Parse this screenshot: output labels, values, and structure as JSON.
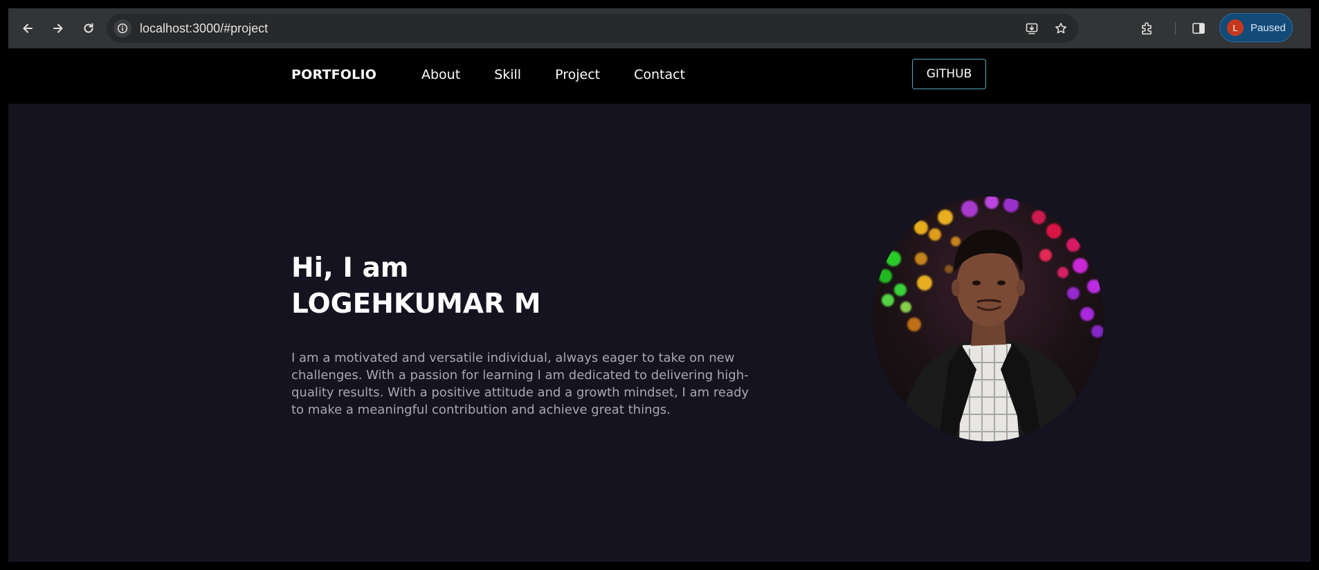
{
  "browser": {
    "url": "localhost:3000/#project",
    "profile": {
      "initial": "L",
      "status": "Paused"
    }
  },
  "nav": {
    "brand": "PORTFOLIO",
    "links": [
      "About",
      "Skill",
      "Project",
      "Contact"
    ],
    "github_label": "GITHUB"
  },
  "hero": {
    "greeting": "Hi, I am",
    "name": "LOGEHKUMAR M",
    "bio": "I am a motivated and versatile individual, always eager to take on new challenges. With a passion for learning I am dedicated to delivering high-quality results. With a positive attitude and a growth mindset, I am ready to make a meaningful contribution and achieve great things."
  },
  "colors": {
    "nav_bg": "#000000",
    "hero_bg": "#15131f",
    "bio_text": "#a9a7b1",
    "github_border": "#62a9c4",
    "profile_chip": "#124a78",
    "avatar": "#c5381e"
  }
}
